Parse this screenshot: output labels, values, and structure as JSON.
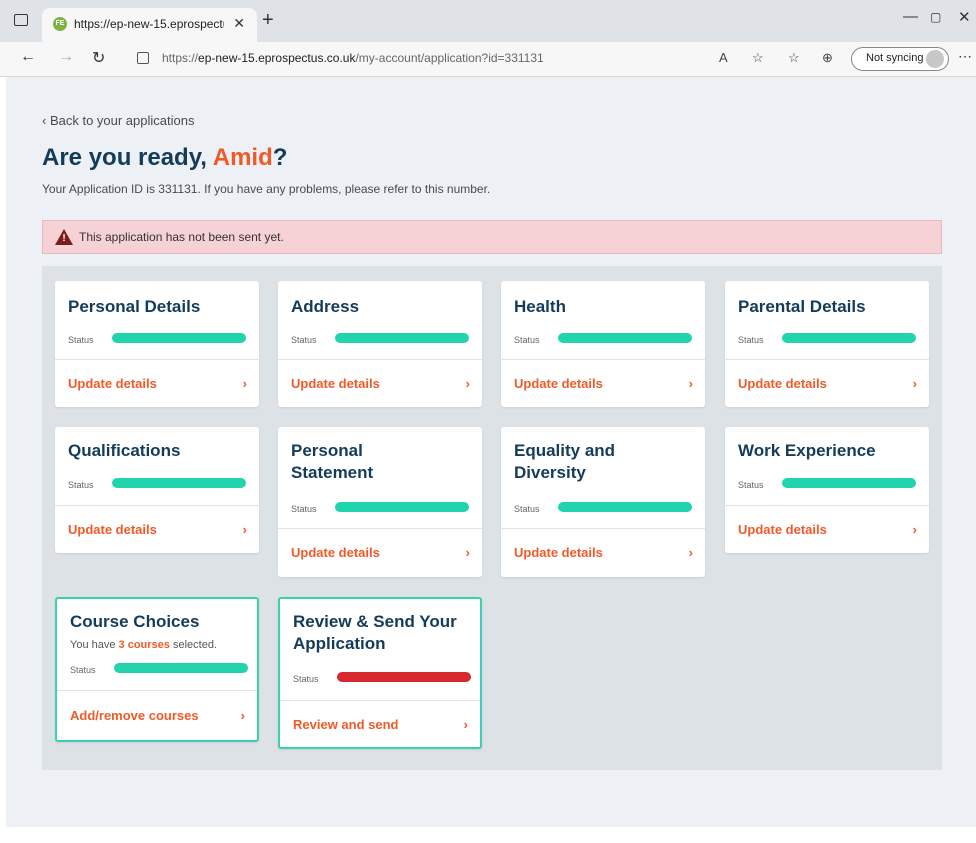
{
  "browser": {
    "tab_title": "https://ep-new-15.eprospectus.c",
    "tab_favicon": "FE",
    "url_prefix": "https://",
    "url_host": "ep-new-15.eprospectus.co.uk",
    "url_path": "/my-account/application?id=331131",
    "sync_label": "Not syncing"
  },
  "page": {
    "back_link": "‹ Back to your applications",
    "heading_prefix": "Are you ready, ",
    "heading_name": "Amid",
    "heading_suffix": "?",
    "subtext": "Your Application ID is 331131. If you have any problems, please refer to this number.",
    "alert_text": "This application has not been sent yet."
  },
  "colors": {
    "accent": "#f05a28",
    "heading": "#143c5a",
    "status_complete": "#22d4ae",
    "status_incomplete": "#d6282e",
    "alert_bg": "#f6d1d5"
  },
  "cards": {
    "status_label": "Status",
    "update_label": "Update details",
    "personal_details": "Personal Details",
    "address": "Address",
    "health": "Health",
    "parental_details": "Parental Details",
    "qualifications": "Qualifications",
    "personal_statement": "Personal Statement",
    "equality_diversity": "Equality and Diversity",
    "work_experience": "Work Experience",
    "course_choices": {
      "title": "Course Choices",
      "info_prefix": "You have ",
      "count": "3 courses",
      "info_suffix": " selected.",
      "link": "Add/remove courses"
    },
    "review_send": {
      "title": "Review & Send Your Application",
      "link": "Review and send"
    }
  }
}
